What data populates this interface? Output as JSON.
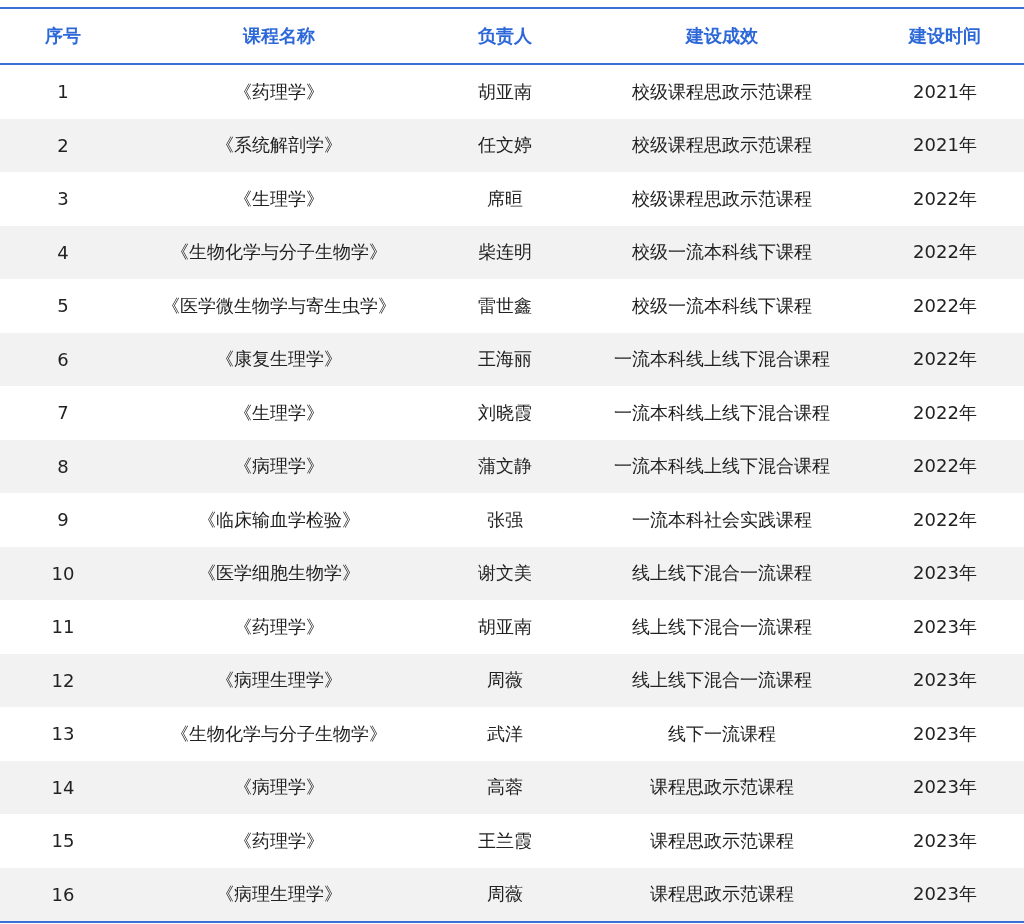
{
  "table": {
    "columns": [
      "序号",
      "课程名称",
      "负责人",
      "建设成效",
      "建设时间"
    ],
    "rows": [
      [
        "1",
        "《药理学》",
        "胡亚南",
        "校级课程思政示范课程",
        "2021年"
      ],
      [
        "2",
        "《系统解剖学》",
        "任文婷",
        "校级课程思政示范课程",
        "2021年"
      ],
      [
        "3",
        "《生理学》",
        "席晅",
        "校级课程思政示范课程",
        "2022年"
      ],
      [
        "4",
        "《生物化学与分子生物学》",
        "柴连明",
        "校级一流本科线下课程",
        "2022年"
      ],
      [
        "5",
        "《医学微生物学与寄生虫学》",
        "雷世鑫",
        "校级一流本科线下课程",
        "2022年"
      ],
      [
        "6",
        "《康复生理学》",
        "王海丽",
        "一流本科线上线下混合课程",
        "2022年"
      ],
      [
        "7",
        "《生理学》",
        "刘晓霞",
        "一流本科线上线下混合课程",
        "2022年"
      ],
      [
        "8",
        "《病理学》",
        "蒲文静",
        "一流本科线上线下混合课程",
        "2022年"
      ],
      [
        "9",
        "《临床输血学检验》",
        "张强",
        "一流本科社会实践课程",
        "2022年"
      ],
      [
        "10",
        "《医学细胞生物学》",
        "谢文美",
        "线上线下混合一流课程",
        "2023年"
      ],
      [
        "11",
        "《药理学》",
        "胡亚南",
        "线上线下混合一流课程",
        "2023年"
      ],
      [
        "12",
        "《病理生理学》",
        "周薇",
        "线上线下混合一流课程",
        "2023年"
      ],
      [
        "13",
        "《生物化学与分子生物学》",
        "武洋",
        "线下一流课程",
        "2023年"
      ],
      [
        "14",
        "《病理学》",
        "高蓉",
        "课程思政示范课程",
        "2023年"
      ],
      [
        "15",
        "《药理学》",
        "王兰霞",
        "课程思政示范课程",
        "2023年"
      ],
      [
        "16",
        "《病理生理学》",
        "周薇",
        "课程思政示范课程",
        "2023年"
      ]
    ]
  }
}
